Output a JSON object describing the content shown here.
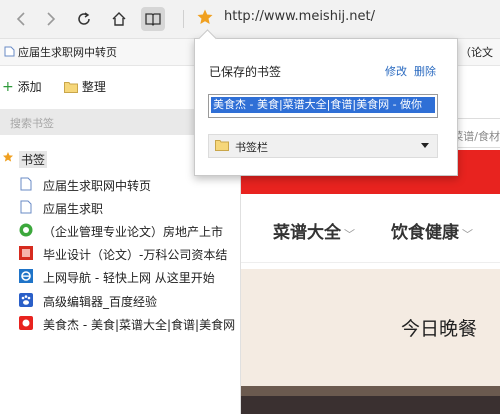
{
  "toolbar": {
    "url": "http://www.meishij.net/",
    "icons": [
      "back-icon",
      "forward-icon",
      "refresh-icon",
      "home-icon",
      "reading-view-icon",
      "favorite-star-icon"
    ]
  },
  "favorites_bar": {
    "items": [
      {
        "label": "应届生求职网中转页"
      },
      {
        "label": "（论文"
      }
    ]
  },
  "hub": {
    "add_label": "添加",
    "organize_label": "整理",
    "search_placeholder": "搜索书签",
    "folder_label": "书签",
    "bookmarks": [
      {
        "label": "应届生求职网中转页",
        "icon": "bookmark-page-icon"
      },
      {
        "label": "应届生求职",
        "icon": "bookmark-page-icon"
      },
      {
        "label": "（企业管理专业论文）房地产上市",
        "icon": "green-site-icon"
      },
      {
        "label": "毕业设计（论文）-万科公司资本结",
        "icon": "red-site-icon"
      },
      {
        "label": "上网导航 - 轻快上网 从这里开始",
        "icon": "ie-icon"
      },
      {
        "label": "高级编辑器_百度经验",
        "icon": "baidu-paw-icon"
      },
      {
        "label": "美食杰 - 美食|菜谱大全|食谱|美食网",
        "icon": "meishij-icon"
      }
    ]
  },
  "popup": {
    "title": "已保存的书签",
    "edit_label": "修改",
    "delete_label": "删除",
    "name_value": "美食杰 - 美食|菜谱大全|食谱|美食网 - 做你",
    "folder_value": "书签栏"
  },
  "page": {
    "search_hint": "菜谱/食材",
    "nav": [
      {
        "label": "菜谱大全"
      },
      {
        "label": "饮食健康"
      }
    ],
    "banner_text": "今日晚餐"
  },
  "colors": {
    "accent_blue": "#2a6ac0",
    "selection_blue": "#2f6fd6",
    "brand_red": "#e8231f",
    "star_orange": "#f0a020"
  }
}
